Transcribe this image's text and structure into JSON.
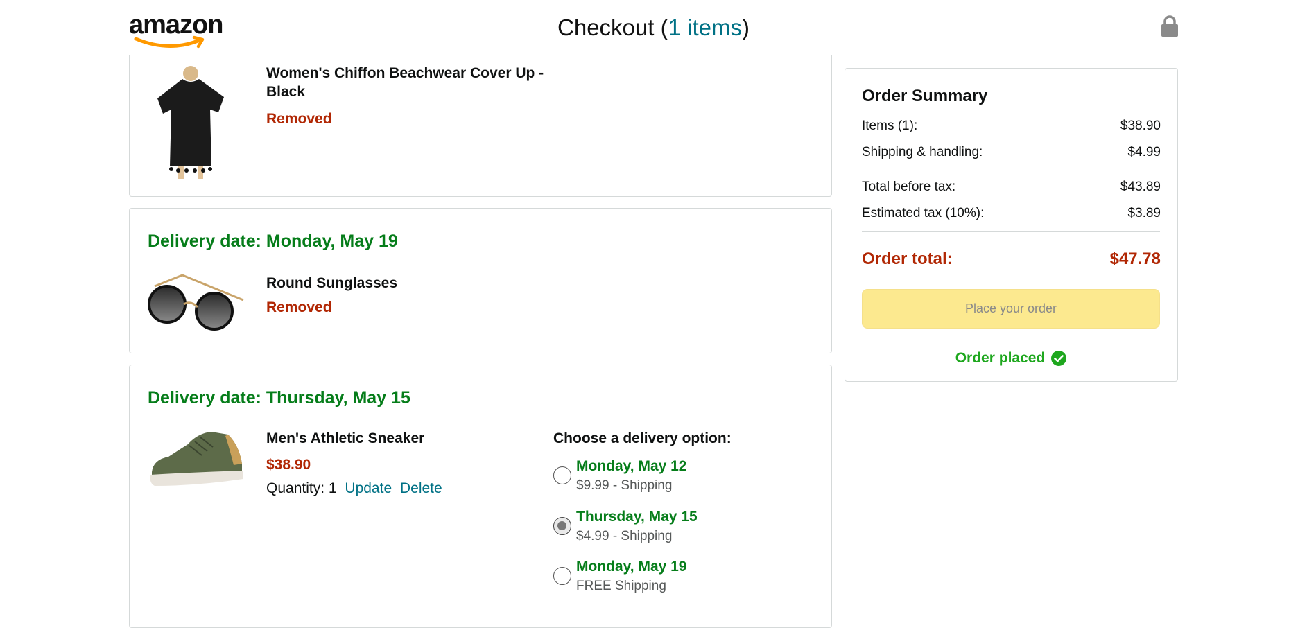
{
  "header": {
    "logo_text": "amazon",
    "title_prefix": "Checkout (",
    "title_count": "1 items",
    "title_suffix": ")",
    "lock_icon": "lock-icon"
  },
  "items": [
    {
      "delivery_date": "",
      "title": "Women's Chiffon Beachwear Cover Up - Black",
      "status": "Removed",
      "image": "black-chiffon-cover-up"
    },
    {
      "delivery_date": "Delivery date: Monday, May 19",
      "title": "Round Sunglasses",
      "status": "Removed",
      "image": "round-sunglasses"
    },
    {
      "delivery_date": "Delivery date: Thursday, May 15",
      "title": "Men's Athletic Sneaker",
      "price": "$38.90",
      "quantity_label": "Quantity: 1",
      "update_link": "Update",
      "delete_link": "Delete",
      "image": "green-athletic-sneaker",
      "delivery_heading": "Choose a delivery option:",
      "options": [
        {
          "date": "Monday, May 12",
          "shipping": "$9.99 - Shipping",
          "selected": false
        },
        {
          "date": "Thursday, May 15",
          "shipping": "$4.99 - Shipping",
          "selected": true
        },
        {
          "date": "Monday, May 19",
          "shipping": "FREE Shipping",
          "selected": false
        }
      ]
    }
  ],
  "summary": {
    "title": "Order Summary",
    "rows": [
      {
        "label": "Items (1):",
        "value": "$38.90"
      },
      {
        "label": "Shipping & handling:",
        "value": "$4.99"
      },
      {
        "label": "Total before tax:",
        "value": "$43.89"
      },
      {
        "label": "Estimated tax (10%):",
        "value": "$3.89"
      }
    ],
    "total_label": "Order total:",
    "total_value": "$47.78",
    "place_button": "Place your order",
    "status": "Order placed"
  },
  "colors": {
    "green": "#067d1a",
    "red": "#b12704",
    "link": "#007185",
    "button": "#fce98f"
  }
}
